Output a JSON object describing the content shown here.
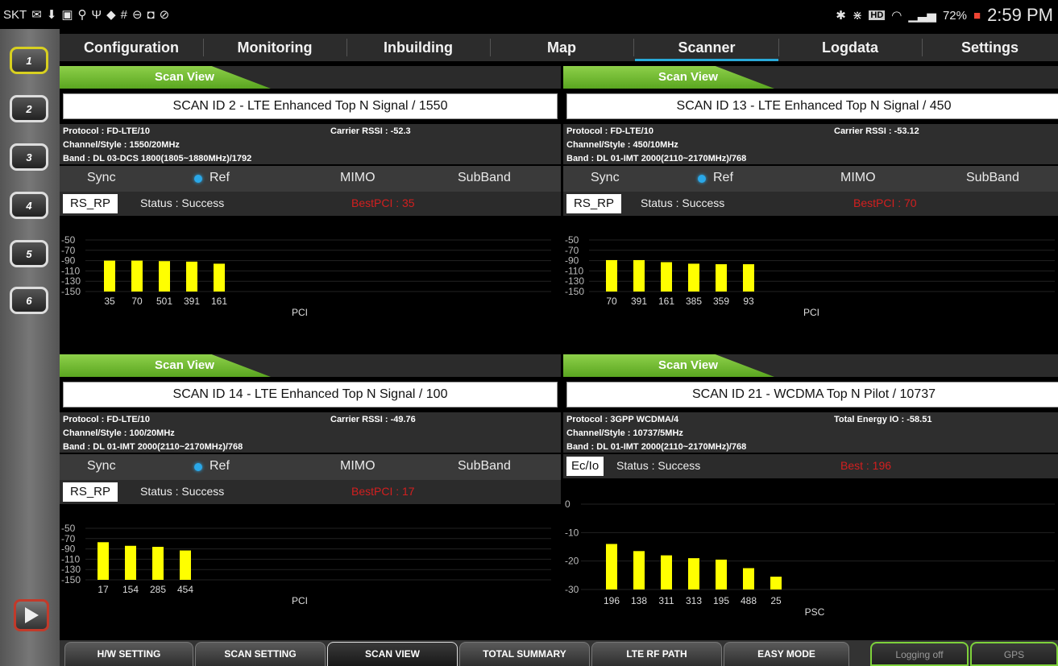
{
  "status_bar": {
    "carrier": "SKT",
    "battery": "72%",
    "time": "2:59 PM",
    "hd_label": "HD"
  },
  "sidebar": {
    "buttons": [
      "1",
      "2",
      "3",
      "4",
      "5",
      "6"
    ],
    "active": "1"
  },
  "tabs": [
    "Configuration",
    "Monitoring",
    "Inbuilding",
    "Map",
    "Scanner",
    "Logdata",
    "Settings"
  ],
  "active_tab": "Scanner",
  "panels": [
    {
      "header": "Scan View",
      "title": "SCAN ID 2 - LTE Enhanced Top N Signal / 1550",
      "protocol": "Protocol : FD-LTE/10",
      "channel": "Channel/Style : 1550/20MHz",
      "band": "Band : DL 03-DCS 1800(1805~1880MHz)/1792",
      "rssi": "Carrier RSSI : -52.3",
      "options": {
        "sync": "Sync",
        "ref": "Ref",
        "mimo": "MIMO",
        "subband": "SubBand"
      },
      "measure": "RS_RP",
      "status": "Status : Success",
      "best": "BestPCI : 35"
    },
    {
      "header": "Scan View",
      "title": "SCAN ID 13 - LTE Enhanced Top N Signal / 450",
      "protocol": "Protocol : FD-LTE/10",
      "channel": "Channel/Style : 450/10MHz",
      "band": "Band : DL 01-IMT 2000(2110~2170MHz)/768",
      "rssi": "Carrier RSSI : -53.12",
      "options": {
        "sync": "Sync",
        "ref": "Ref",
        "mimo": "MIMO",
        "subband": "SubBand"
      },
      "measure": "RS_RP",
      "status": "Status : Success",
      "best": "BestPCI : 70"
    },
    {
      "header": "Scan View",
      "title": "SCAN ID 14 - LTE Enhanced Top N Signal / 100",
      "protocol": "Protocol : FD-LTE/10",
      "channel": "Channel/Style : 100/20MHz",
      "band": "Band : DL 01-IMT 2000(2110~2170MHz)/768",
      "rssi": "Carrier RSSI : -49.76",
      "options": {
        "sync": "Sync",
        "ref": "Ref",
        "mimo": "MIMO",
        "subband": "SubBand"
      },
      "measure": "RS_RP",
      "status": "Status : Success",
      "best": "BestPCI : 17"
    },
    {
      "header": "Scan View",
      "title": "SCAN ID 21 - WCDMA Top N Pilot / 10737",
      "protocol": "Protocol : 3GPP WCDMA/4",
      "channel": "Channel/Style : 10737/5MHz",
      "band": "Band : DL 01-IMT 2000(2110~2170MHz)/768",
      "rssi": "Total Energy IO : -58.51",
      "measure": "Ec/Io",
      "status": "Status : Success",
      "best": "Best : 196"
    }
  ],
  "chart_data": [
    {
      "type": "bar",
      "categories": [
        "35",
        "70",
        "501",
        "391",
        "161"
      ],
      "values": [
        -90,
        -90,
        -91,
        -92,
        -96
      ],
      "xlabel": "PCI",
      "yticks": [
        "-50",
        "-70",
        "-90",
        "-110",
        "-130",
        "-150"
      ],
      "ylim": [
        -150,
        -50
      ],
      "bar_color": "#ffff00"
    },
    {
      "type": "bar",
      "categories": [
        "70",
        "391",
        "161",
        "385",
        "359",
        "93"
      ],
      "values": [
        -89,
        -89,
        -93,
        -96,
        -97,
        -97
      ],
      "xlabel": "PCI",
      "yticks": [
        "-50",
        "-70",
        "-90",
        "-110",
        "-130",
        "-150"
      ],
      "ylim": [
        -150,
        -50
      ],
      "bar_color": "#ffff00"
    },
    {
      "type": "bar",
      "categories": [
        "17",
        "154",
        "285",
        "454"
      ],
      "values": [
        -77,
        -84,
        -86,
        -93
      ],
      "xlabel": "PCI",
      "yticks": [
        "-50",
        "-70",
        "-90",
        "-110",
        "-130",
        "-150"
      ],
      "ylim": [
        -150,
        -50
      ],
      "bar_color": "#ffff00"
    },
    {
      "type": "bar",
      "categories": [
        "196",
        "138",
        "311",
        "313",
        "195",
        "488",
        "25"
      ],
      "values": [
        -14,
        -16.5,
        -18,
        -19,
        -19.5,
        -22.5,
        -25.5
      ],
      "xlabel": "PSC",
      "yticks": [
        "0",
        "-10",
        "-20",
        "-30"
      ],
      "ylim": [
        -30,
        0
      ],
      "bar_color": "#ffff00"
    }
  ],
  "bottom_buttons": [
    "H/W SETTING",
    "SCAN SETTING",
    "SCAN VIEW",
    "TOTAL SUMMARY",
    "LTE RF PATH",
    "EASY MODE",
    "Logging off",
    "GPS"
  ],
  "active_bottom": "SCAN VIEW"
}
